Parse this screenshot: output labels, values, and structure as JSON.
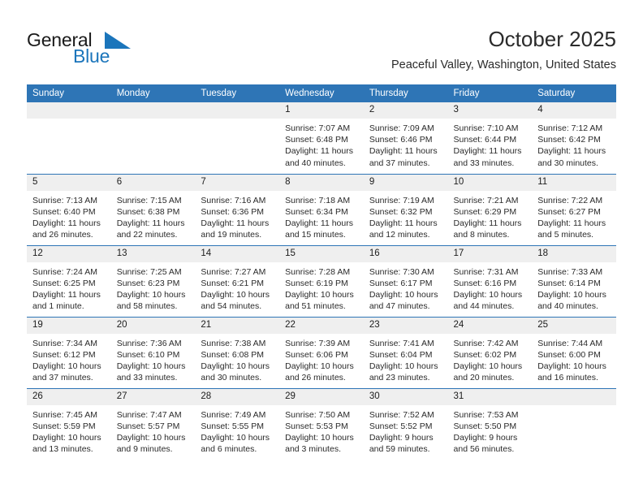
{
  "brand": {
    "name_part1": "General",
    "name_part2": "Blue"
  },
  "header": {
    "title": "October 2025",
    "subtitle": "Peaceful Valley, Washington, United States"
  },
  "colors": {
    "header_blue": "#2e75b6",
    "brand_blue": "#1b75bb",
    "daynum_band": "#efefef",
    "text": "#2a2a2a"
  },
  "weekday_headers": [
    "Sunday",
    "Monday",
    "Tuesday",
    "Wednesday",
    "Thursday",
    "Friday",
    "Saturday"
  ],
  "weeks": [
    [
      {
        "day": "",
        "blank": true
      },
      {
        "day": "",
        "blank": true
      },
      {
        "day": "",
        "blank": true
      },
      {
        "day": "1",
        "sunrise": "Sunrise: 7:07 AM",
        "sunset": "Sunset: 6:48 PM",
        "daylight1": "Daylight: 11 hours",
        "daylight2": "and 40 minutes."
      },
      {
        "day": "2",
        "sunrise": "Sunrise: 7:09 AM",
        "sunset": "Sunset: 6:46 PM",
        "daylight1": "Daylight: 11 hours",
        "daylight2": "and 37 minutes."
      },
      {
        "day": "3",
        "sunrise": "Sunrise: 7:10 AM",
        "sunset": "Sunset: 6:44 PM",
        "daylight1": "Daylight: 11 hours",
        "daylight2": "and 33 minutes."
      },
      {
        "day": "4",
        "sunrise": "Sunrise: 7:12 AM",
        "sunset": "Sunset: 6:42 PM",
        "daylight1": "Daylight: 11 hours",
        "daylight2": "and 30 minutes."
      }
    ],
    [
      {
        "day": "5",
        "sunrise": "Sunrise: 7:13 AM",
        "sunset": "Sunset: 6:40 PM",
        "daylight1": "Daylight: 11 hours",
        "daylight2": "and 26 minutes."
      },
      {
        "day": "6",
        "sunrise": "Sunrise: 7:15 AM",
        "sunset": "Sunset: 6:38 PM",
        "daylight1": "Daylight: 11 hours",
        "daylight2": "and 22 minutes."
      },
      {
        "day": "7",
        "sunrise": "Sunrise: 7:16 AM",
        "sunset": "Sunset: 6:36 PM",
        "daylight1": "Daylight: 11 hours",
        "daylight2": "and 19 minutes."
      },
      {
        "day": "8",
        "sunrise": "Sunrise: 7:18 AM",
        "sunset": "Sunset: 6:34 PM",
        "daylight1": "Daylight: 11 hours",
        "daylight2": "and 15 minutes."
      },
      {
        "day": "9",
        "sunrise": "Sunrise: 7:19 AM",
        "sunset": "Sunset: 6:32 PM",
        "daylight1": "Daylight: 11 hours",
        "daylight2": "and 12 minutes."
      },
      {
        "day": "10",
        "sunrise": "Sunrise: 7:21 AM",
        "sunset": "Sunset: 6:29 PM",
        "daylight1": "Daylight: 11 hours",
        "daylight2": "and 8 minutes."
      },
      {
        "day": "11",
        "sunrise": "Sunrise: 7:22 AM",
        "sunset": "Sunset: 6:27 PM",
        "daylight1": "Daylight: 11 hours",
        "daylight2": "and 5 minutes."
      }
    ],
    [
      {
        "day": "12",
        "sunrise": "Sunrise: 7:24 AM",
        "sunset": "Sunset: 6:25 PM",
        "daylight1": "Daylight: 11 hours",
        "daylight2": "and 1 minute."
      },
      {
        "day": "13",
        "sunrise": "Sunrise: 7:25 AM",
        "sunset": "Sunset: 6:23 PM",
        "daylight1": "Daylight: 10 hours",
        "daylight2": "and 58 minutes."
      },
      {
        "day": "14",
        "sunrise": "Sunrise: 7:27 AM",
        "sunset": "Sunset: 6:21 PM",
        "daylight1": "Daylight: 10 hours",
        "daylight2": "and 54 minutes."
      },
      {
        "day": "15",
        "sunrise": "Sunrise: 7:28 AM",
        "sunset": "Sunset: 6:19 PM",
        "daylight1": "Daylight: 10 hours",
        "daylight2": "and 51 minutes."
      },
      {
        "day": "16",
        "sunrise": "Sunrise: 7:30 AM",
        "sunset": "Sunset: 6:17 PM",
        "daylight1": "Daylight: 10 hours",
        "daylight2": "and 47 minutes."
      },
      {
        "day": "17",
        "sunrise": "Sunrise: 7:31 AM",
        "sunset": "Sunset: 6:16 PM",
        "daylight1": "Daylight: 10 hours",
        "daylight2": "and 44 minutes."
      },
      {
        "day": "18",
        "sunrise": "Sunrise: 7:33 AM",
        "sunset": "Sunset: 6:14 PM",
        "daylight1": "Daylight: 10 hours",
        "daylight2": "and 40 minutes."
      }
    ],
    [
      {
        "day": "19",
        "sunrise": "Sunrise: 7:34 AM",
        "sunset": "Sunset: 6:12 PM",
        "daylight1": "Daylight: 10 hours",
        "daylight2": "and 37 minutes."
      },
      {
        "day": "20",
        "sunrise": "Sunrise: 7:36 AM",
        "sunset": "Sunset: 6:10 PM",
        "daylight1": "Daylight: 10 hours",
        "daylight2": "and 33 minutes."
      },
      {
        "day": "21",
        "sunrise": "Sunrise: 7:38 AM",
        "sunset": "Sunset: 6:08 PM",
        "daylight1": "Daylight: 10 hours",
        "daylight2": "and 30 minutes."
      },
      {
        "day": "22",
        "sunrise": "Sunrise: 7:39 AM",
        "sunset": "Sunset: 6:06 PM",
        "daylight1": "Daylight: 10 hours",
        "daylight2": "and 26 minutes."
      },
      {
        "day": "23",
        "sunrise": "Sunrise: 7:41 AM",
        "sunset": "Sunset: 6:04 PM",
        "daylight1": "Daylight: 10 hours",
        "daylight2": "and 23 minutes."
      },
      {
        "day": "24",
        "sunrise": "Sunrise: 7:42 AM",
        "sunset": "Sunset: 6:02 PM",
        "daylight1": "Daylight: 10 hours",
        "daylight2": "and 20 minutes."
      },
      {
        "day": "25",
        "sunrise": "Sunrise: 7:44 AM",
        "sunset": "Sunset: 6:00 PM",
        "daylight1": "Daylight: 10 hours",
        "daylight2": "and 16 minutes."
      }
    ],
    [
      {
        "day": "26",
        "sunrise": "Sunrise: 7:45 AM",
        "sunset": "Sunset: 5:59 PM",
        "daylight1": "Daylight: 10 hours",
        "daylight2": "and 13 minutes."
      },
      {
        "day": "27",
        "sunrise": "Sunrise: 7:47 AM",
        "sunset": "Sunset: 5:57 PM",
        "daylight1": "Daylight: 10 hours",
        "daylight2": "and 9 minutes."
      },
      {
        "day": "28",
        "sunrise": "Sunrise: 7:49 AM",
        "sunset": "Sunset: 5:55 PM",
        "daylight1": "Daylight: 10 hours",
        "daylight2": "and 6 minutes."
      },
      {
        "day": "29",
        "sunrise": "Sunrise: 7:50 AM",
        "sunset": "Sunset: 5:53 PM",
        "daylight1": "Daylight: 10 hours",
        "daylight2": "and 3 minutes."
      },
      {
        "day": "30",
        "sunrise": "Sunrise: 7:52 AM",
        "sunset": "Sunset: 5:52 PM",
        "daylight1": "Daylight: 9 hours",
        "daylight2": "and 59 minutes."
      },
      {
        "day": "31",
        "sunrise": "Sunrise: 7:53 AM",
        "sunset": "Sunset: 5:50 PM",
        "daylight1": "Daylight: 9 hours",
        "daylight2": "and 56 minutes."
      },
      {
        "day": "",
        "blank": true
      }
    ]
  ]
}
